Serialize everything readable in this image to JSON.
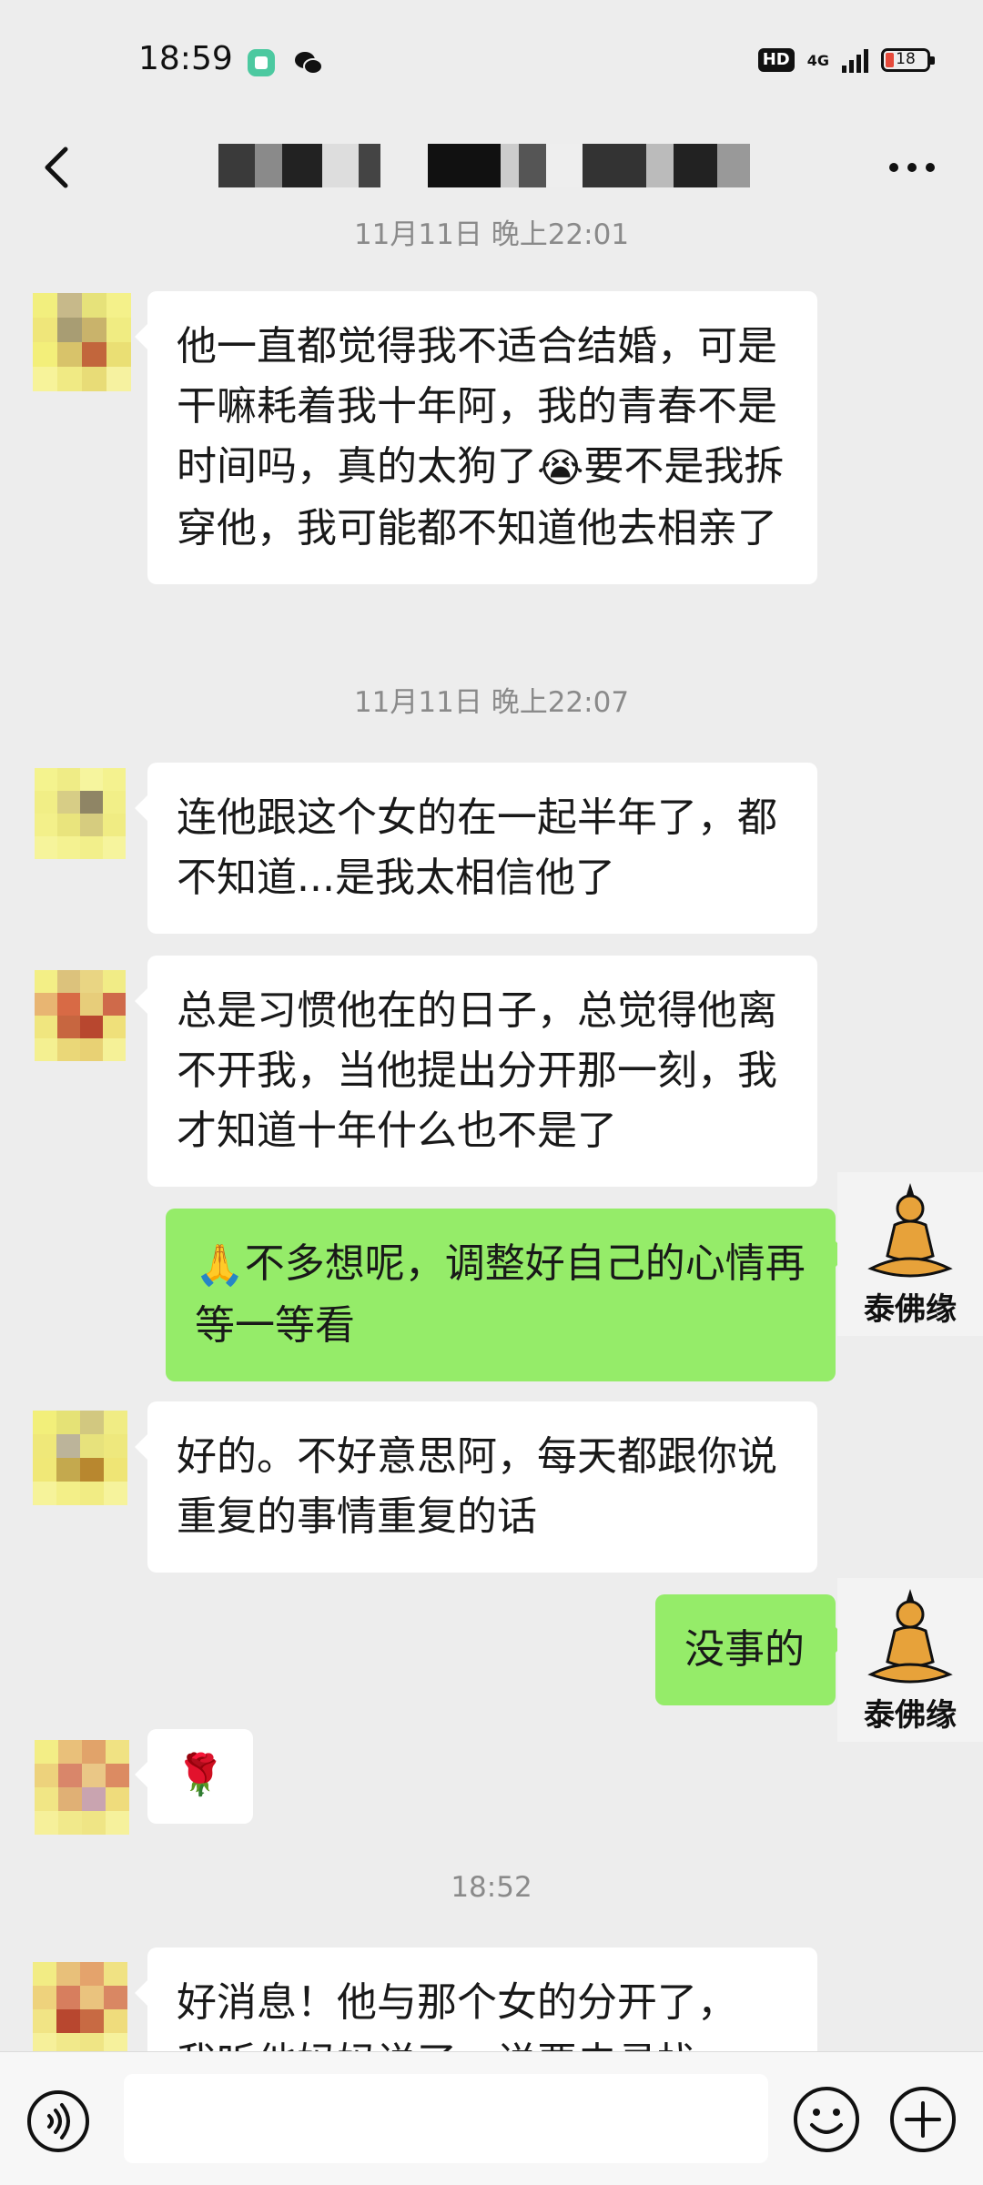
{
  "status_bar": {
    "time": "18:59",
    "hd_label": "HD",
    "network_label": "4G",
    "battery_level": "18"
  },
  "header": {
    "title": "",
    "back_icon": "chevron-left-icon",
    "more_icon": "more-dots-icon"
  },
  "messages": {
    "ts1": "11月11日 晚上22:01",
    "m1": "他一直都觉得我不适合结婚，可是干嘛耗着我十年阿，我的青春不是时间吗，真的太狗了",
    "m1_emoji": "😭",
    "m1_tail": "要不是我拆穿他，我可能都不知道他去相亲了",
    "ts2": "11月11日 晚上22:07",
    "m2": "连他跟这个女的在一起半年了，都不知道...是我太相信他了",
    "m3": "总是习惯他在的日子，总觉得他离不开我，当他提出分开那一刻，我才知道十年什么也不是了",
    "m4_emoji": "🙏",
    "m4": "不多想呢，调整好自己的心情再等一等看",
    "m5": "好的。不好意思阿，每天都跟你说重复的事情重复的话",
    "m6": "没事的",
    "m7_emoji": "🌹",
    "ts3": "18:52",
    "m8": "好消息！他与那个女的分开了，",
    "m8_cut": "我听他妈妈说了，说要去寻找"
  },
  "my_avatar": {
    "label": "泰佛缘"
  },
  "input_bar": {
    "placeholder": "",
    "voice_icon": "voice-icon",
    "emoji_icon": "smile-icon",
    "plus_icon": "plus-icon"
  },
  "colors": {
    "background": "#ededed",
    "incoming_bubble": "#ffffff",
    "outgoing_bubble": "#95ec69",
    "timestamp": "#8a8a8a"
  }
}
